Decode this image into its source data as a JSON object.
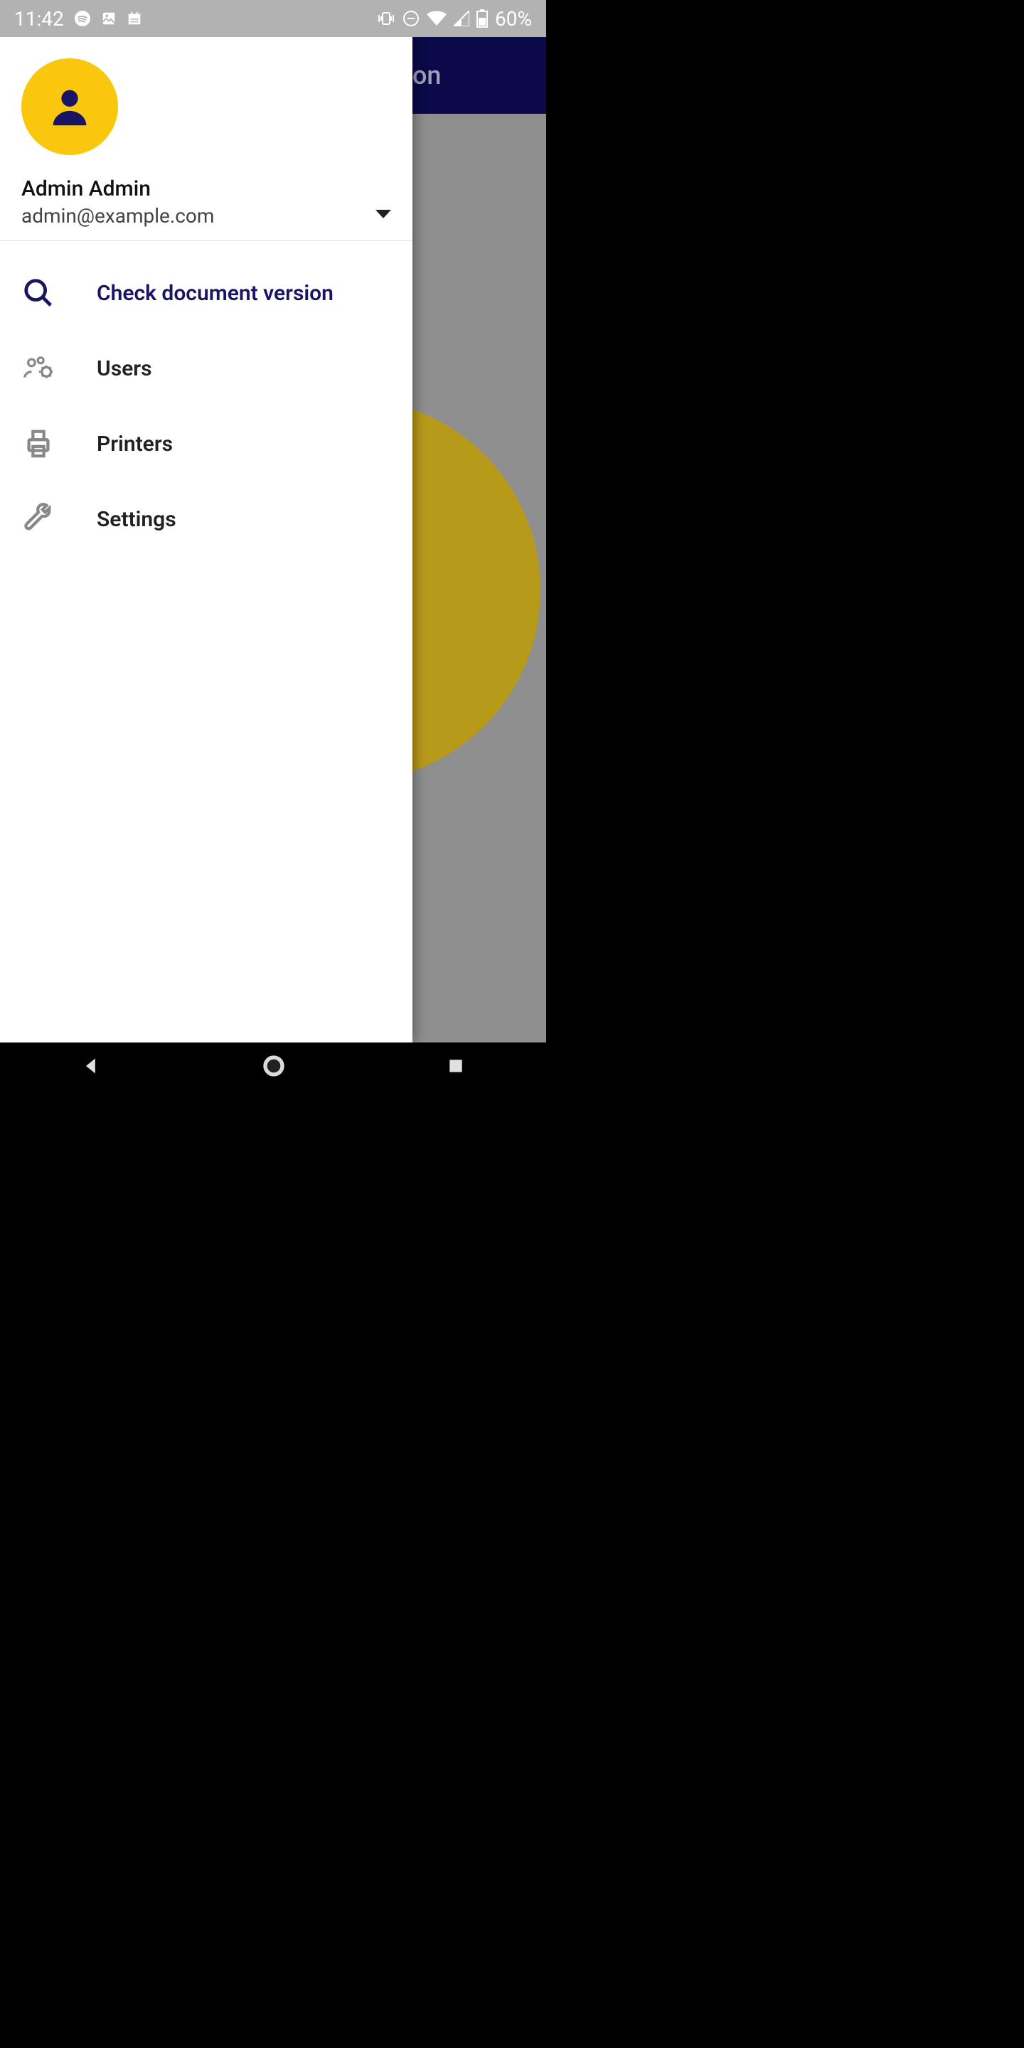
{
  "status": {
    "time": "11:42",
    "battery": "60%"
  },
  "header": {
    "title_fragment": "on"
  },
  "drawer": {
    "user_name": "Admin Admin",
    "user_email": "admin@example.com",
    "items": [
      {
        "label": "Check document version",
        "icon": "search-icon",
        "active": true
      },
      {
        "label": "Users",
        "icon": "users-gear-icon",
        "active": false
      },
      {
        "label": "Printers",
        "icon": "printer-icon",
        "active": false
      },
      {
        "label": "Settings",
        "icon": "wrench-icon",
        "active": false
      }
    ]
  },
  "colors": {
    "accent": "#1a1464",
    "avatar_bg": "#f9c80e"
  }
}
